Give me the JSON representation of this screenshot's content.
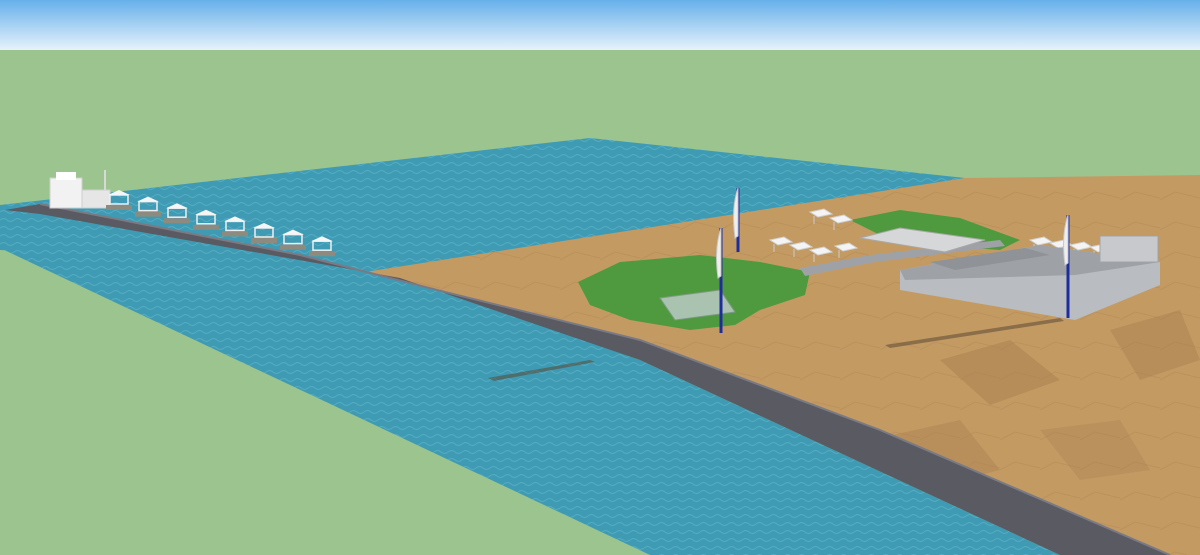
{
  "viewport": {
    "title": ""
  },
  "palette": {
    "sky_top": "#66b0ea",
    "sky_bottom": "#e6f2fb",
    "grass": "#9bc48f",
    "water": "#3f9bb3",
    "water_dark": "#2f8aa6",
    "sand": "#c49a63",
    "sand_dark": "#a87f4f",
    "breakwater": "#5a5a62",
    "turf": "#4f9a3f",
    "building": "#b9bcc0",
    "structure_white": "#f2f2f2",
    "flag_pole": "#1f2d9c"
  },
  "elements": {
    "lagoon": "sea-water",
    "channel": "sea-channel",
    "beach": "sand-beach",
    "pier": "breakwater-pier",
    "cabanas": "beach-cabanas",
    "tents": "shade-tents",
    "terrace": "grass-terrace",
    "pavilion": "main-pavilion",
    "flags": "beach-flags"
  },
  "counts": {
    "cabanas": 8,
    "flags": 3
  }
}
